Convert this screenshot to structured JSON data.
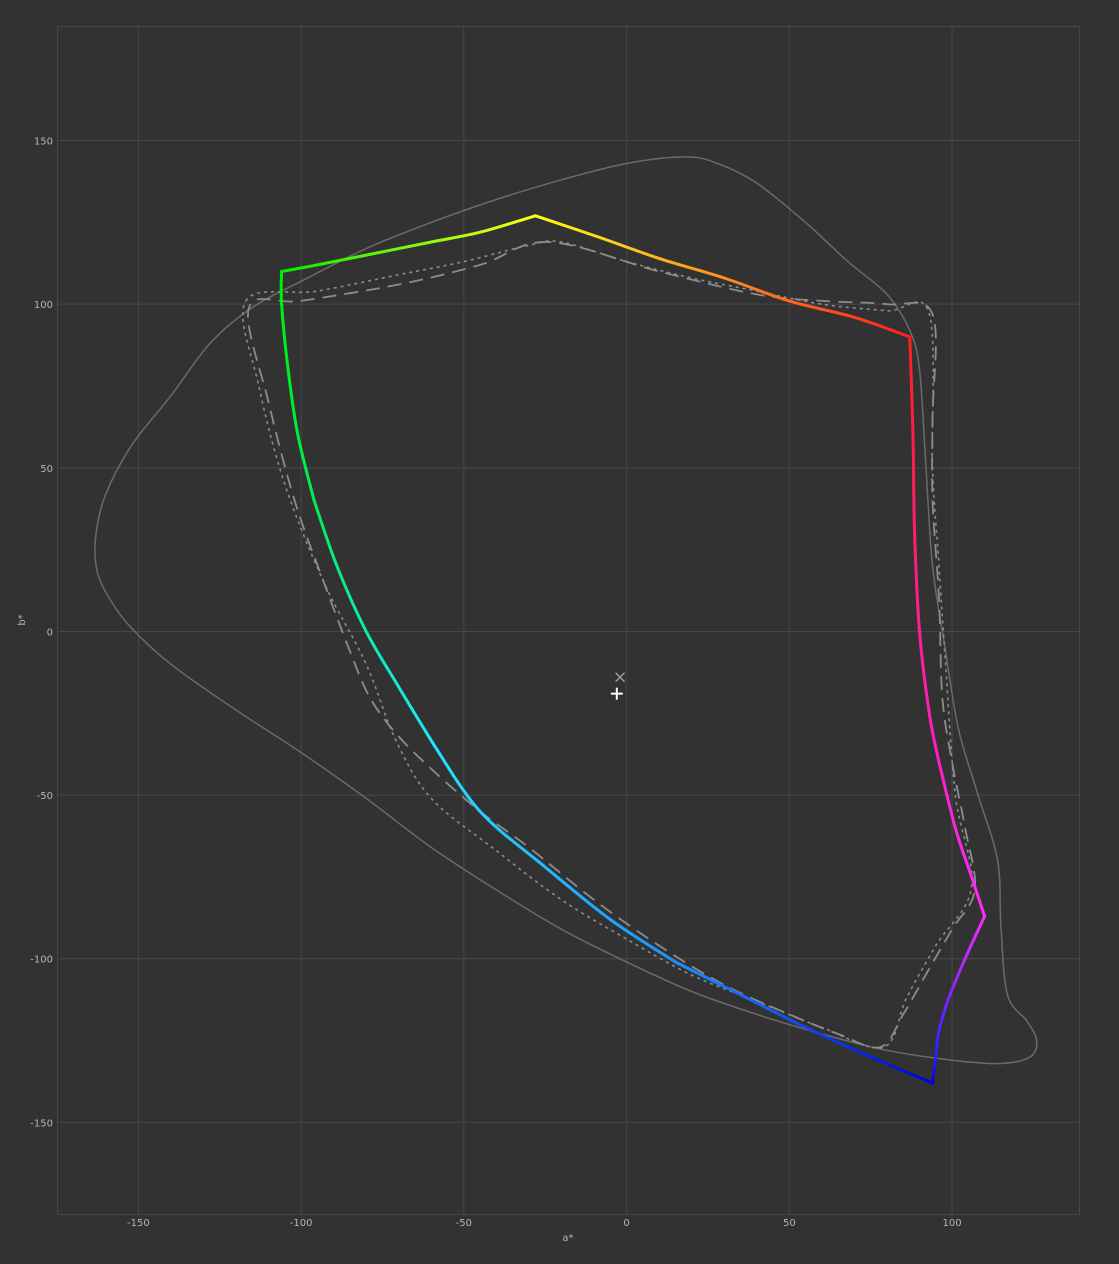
{
  "chart_data": {
    "type": "line",
    "title": "",
    "xlabel": "a*",
    "ylabel": "b*",
    "xlim": [
      -175,
      139
    ],
    "ylim": [
      -178,
      185
    ],
    "grid": true,
    "legend": "none",
    "x_ticks": [
      -150,
      -100,
      -50,
      0,
      50,
      100
    ],
    "y_ticks": [
      150,
      100,
      50,
      0,
      -50,
      -100,
      -150
    ],
    "x_tick_labels": [
      "-150",
      "-100",
      "-50",
      "0",
      "50",
      "100"
    ],
    "y_tick_labels": [
      "150",
      "100",
      "50",
      "0",
      "-50",
      "-100",
      "-150"
    ],
    "colors": {
      "background": "#323232",
      "grid": "#474747",
      "tick_text": "#b4b4b4",
      "outline": "#6a6a6a",
      "reference": "#8c8c8c",
      "marker": "#ffffff"
    },
    "series": [
      {
        "style": "solid-gray",
        "closed": true,
        "points": [
          [
            18,
            145
          ],
          [
            0,
            143
          ],
          [
            -20,
            138
          ],
          [
            -40,
            132
          ],
          [
            -60,
            125
          ],
          [
            -80,
            117
          ],
          [
            -100,
            107
          ],
          [
            -115,
            99
          ],
          [
            -128,
            88
          ],
          [
            -140,
            72
          ],
          [
            -152,
            57
          ],
          [
            -160,
            42
          ],
          [
            -163,
            30
          ],
          [
            -163,
            20
          ],
          [
            -160,
            12
          ],
          [
            -153,
            2
          ],
          [
            -140,
            -10
          ],
          [
            -120,
            -24
          ],
          [
            -100,
            -37
          ],
          [
            -80,
            -51
          ],
          [
            -60,
            -66
          ],
          [
            -40,
            -79
          ],
          [
            -20,
            -91
          ],
          [
            0,
            -101
          ],
          [
            20,
            -110
          ],
          [
            40,
            -117
          ],
          [
            60,
            -123
          ],
          [
            80,
            -128
          ],
          [
            100,
            -131
          ],
          [
            115,
            -132
          ],
          [
            124,
            -130
          ],
          [
            126,
            -125
          ],
          [
            123,
            -119
          ],
          [
            117,
            -111
          ],
          [
            115,
            -90
          ],
          [
            114,
            -70
          ],
          [
            108,
            -50
          ],
          [
            102,
            -30
          ],
          [
            98,
            -6
          ],
          [
            94,
            20
          ],
          [
            92,
            50
          ],
          [
            90,
            80
          ],
          [
            87,
            92
          ],
          [
            80,
            103
          ],
          [
            68,
            113
          ],
          [
            55,
            125
          ],
          [
            40,
            137
          ],
          [
            28,
            143
          ],
          [
            18,
            145
          ]
        ]
      },
      {
        "style": "dashed-gray",
        "closed": true,
        "points": [
          [
            -24,
            119
          ],
          [
            -45,
            112
          ],
          [
            -70,
            106
          ],
          [
            -100,
            101
          ],
          [
            -116,
            99
          ],
          [
            -110,
            70
          ],
          [
            -102,
            40
          ],
          [
            -93,
            15
          ],
          [
            -85,
            -6
          ],
          [
            -79,
            -20
          ],
          [
            -71,
            -31
          ],
          [
            -60,
            -42
          ],
          [
            -45,
            -55
          ],
          [
            -30,
            -66
          ],
          [
            -10,
            -82
          ],
          [
            10,
            -96
          ],
          [
            30,
            -108
          ],
          [
            50,
            -117
          ],
          [
            65,
            -123
          ],
          [
            78,
            -127
          ],
          [
            85,
            -117
          ],
          [
            93,
            -103
          ],
          [
            100,
            -91
          ],
          [
            107,
            -79
          ],
          [
            104,
            -60
          ],
          [
            100,
            -40
          ],
          [
            97,
            -20
          ],
          [
            96,
            10
          ],
          [
            94,
            40
          ],
          [
            94,
            65
          ],
          [
            94,
            97
          ],
          [
            80,
            100
          ],
          [
            60,
            101
          ],
          [
            40,
            103
          ],
          [
            10,
            110
          ],
          [
            -24,
            119
          ]
        ]
      },
      {
        "style": "dotted-gray",
        "closed": true,
        "points": [
          [
            -117,
            101
          ],
          [
            -95,
            104
          ],
          [
            -70,
            109
          ],
          [
            -50,
            113
          ],
          [
            -30,
            118
          ],
          [
            -20,
            119
          ],
          [
            0,
            113
          ],
          [
            20,
            108
          ],
          [
            40,
            104
          ],
          [
            60,
            100
          ],
          [
            80,
            98
          ],
          [
            93,
            97
          ],
          [
            94,
            50
          ],
          [
            96,
            20
          ],
          [
            98,
            -10
          ],
          [
            101,
            -50
          ],
          [
            106,
            -78
          ],
          [
            95,
            -96
          ],
          [
            86,
            -112
          ],
          [
            79,
            -127
          ],
          [
            60,
            -121
          ],
          [
            40,
            -113
          ],
          [
            20,
            -105
          ],
          [
            0,
            -94
          ],
          [
            -20,
            -82
          ],
          [
            -40,
            -67
          ],
          [
            -60,
            -51
          ],
          [
            -71,
            -33
          ],
          [
            -80,
            -10
          ],
          [
            -93,
            15
          ],
          [
            -105,
            45
          ],
          [
            -113,
            75
          ],
          [
            -117,
            101
          ]
        ]
      },
      {
        "style": "gradient",
        "segments": [
          {
            "from": "#00ee00",
            "to": "#ffff1a",
            "points": [
              [
                -106,
                110
              ],
              [
                -95,
                112
              ],
              [
                -80,
                115
              ],
              [
                -60,
                119
              ],
              [
                -45,
                122
              ],
              [
                -28,
                127
              ]
            ]
          },
          {
            "from": "#ffff1a",
            "to": "#ff1e1e",
            "points": [
              [
                -28,
                127
              ],
              [
                -10,
                121
              ],
              [
                10,
                114
              ],
              [
                30,
                108
              ],
              [
                50,
                101
              ],
              [
                70,
                96
              ],
              [
                87,
                90
              ]
            ]
          },
          {
            "from": "#ff1e1e",
            "to": "#ff1ecc",
            "points": [
              [
                87,
                90
              ],
              [
                88,
                60
              ],
              [
                88.5,
                30
              ],
              [
                90,
                0
              ],
              [
                93,
                -25
              ],
              [
                96,
                -40
              ]
            ]
          },
          {
            "from": "#ff1ecc",
            "to": "#ff2aff",
            "points": [
              [
                96,
                -40
              ],
              [
                101,
                -60
              ],
              [
                106,
                -75
              ],
              [
                110,
                -87
              ]
            ]
          },
          {
            "from": "#ff2aff",
            "to": "#2222ff",
            "points": [
              [
                110,
                -87
              ],
              [
                104,
                -100
              ],
              [
                99,
                -112
              ],
              [
                96,
                -122
              ],
              [
                95,
                -130
              ]
            ]
          },
          {
            "from": "#2222ff",
            "to": "#0000dd",
            "points": [
              [
                95,
                -130
              ],
              [
                94,
                -138
              ]
            ]
          },
          {
            "from": "#0000dd",
            "to": "#1e90ff",
            "points": [
              [
                94,
                -138
              ],
              [
                75,
                -130
              ],
              [
                55,
                -121
              ],
              [
                35,
                -111
              ],
              [
                15,
                -101
              ]
            ]
          },
          {
            "from": "#1e90ff",
            "to": "#1ee8ff",
            "points": [
              [
                15,
                -101
              ],
              [
                -5,
                -88
              ],
              [
                -25,
                -72
              ],
              [
                -45,
                -55
              ],
              [
                -59,
                -35
              ]
            ]
          },
          {
            "from": "#1ee8ff",
            "to": "#00ee55",
            "points": [
              [
                -59,
                -35
              ],
              [
                -70,
                -17
              ],
              [
                -80,
                0
              ],
              [
                -89,
                20
              ],
              [
                -96,
                40
              ]
            ]
          },
          {
            "from": "#00ee55",
            "to": "#00ee00",
            "points": [
              [
                -96,
                40
              ],
              [
                -101,
                60
              ],
              [
                -104,
                80
              ],
              [
                -106,
                100
              ],
              [
                -106,
                110
              ]
            ]
          }
        ]
      }
    ],
    "markers": [
      {
        "symbol": "x",
        "x": -2,
        "y": -14
      },
      {
        "symbol": "+",
        "x": -3,
        "y": -19
      }
    ]
  }
}
